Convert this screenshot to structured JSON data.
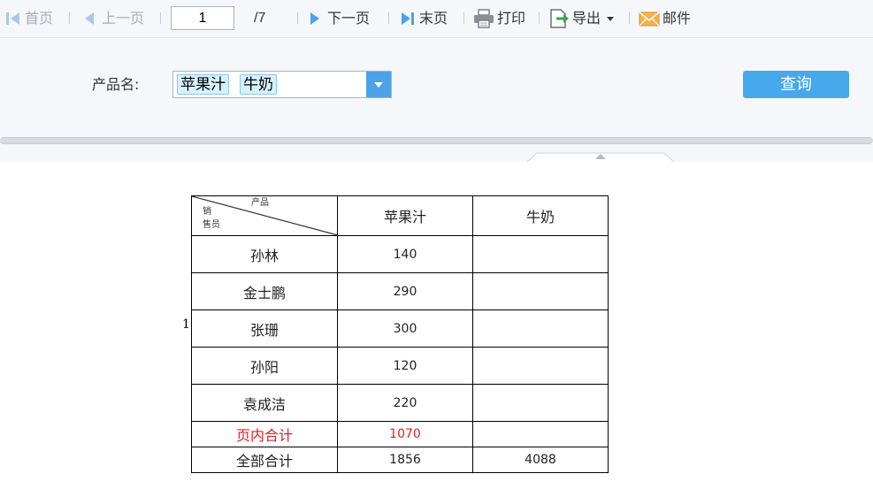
{
  "toolbar": {
    "first_label": "首页",
    "prev_label": "上一页",
    "page_value": "1",
    "page_total": "/7",
    "next_label": "下一页",
    "last_label": "末页",
    "print_label": "打印",
    "export_label": "导出",
    "mail_label": "邮件",
    "icons": [
      "first-page-icon",
      "prev-page-icon",
      "next-page-icon",
      "last-page-icon",
      "printer-icon",
      "export-icon",
      "dropdown-caret-icon",
      "mail-icon"
    ],
    "colors": {
      "nav_arrow": "#4aa3e8",
      "disabled_arrow": "#a8c8e8",
      "export_green": "#3aa64a",
      "mail_orange": "#f0a93a"
    }
  },
  "params": {
    "product_label": "产品名:",
    "selected_tags": [
      "苹果汁",
      "牛奶"
    ],
    "query_button": "查询",
    "colors": {
      "button": "#47a8ec",
      "tag_bg": "#d6f1ff"
    }
  },
  "report": {
    "row_marker": "1",
    "corner_header": {
      "top": "产品",
      "bottom_line1": "销",
      "bottom_line2": "售员"
    },
    "columns": [
      "苹果汁",
      "牛奶"
    ],
    "rows": [
      {
        "name": "孙林",
        "apple": "140",
        "milk": ""
      },
      {
        "name": "金士鹏",
        "apple": "290",
        "milk": ""
      },
      {
        "name": "张珊",
        "apple": "300",
        "milk": ""
      },
      {
        "name": "孙阳",
        "apple": "120",
        "milk": ""
      },
      {
        "name": "袁成洁",
        "apple": "220",
        "milk": ""
      }
    ],
    "page_subtotal": {
      "label": "页内合计",
      "apple": "1070",
      "milk": ""
    },
    "grand_total": {
      "label": "全部合计",
      "apple": "1856",
      "milk": "4088"
    },
    "colors": {
      "subtotal_text": "#e02020"
    }
  }
}
